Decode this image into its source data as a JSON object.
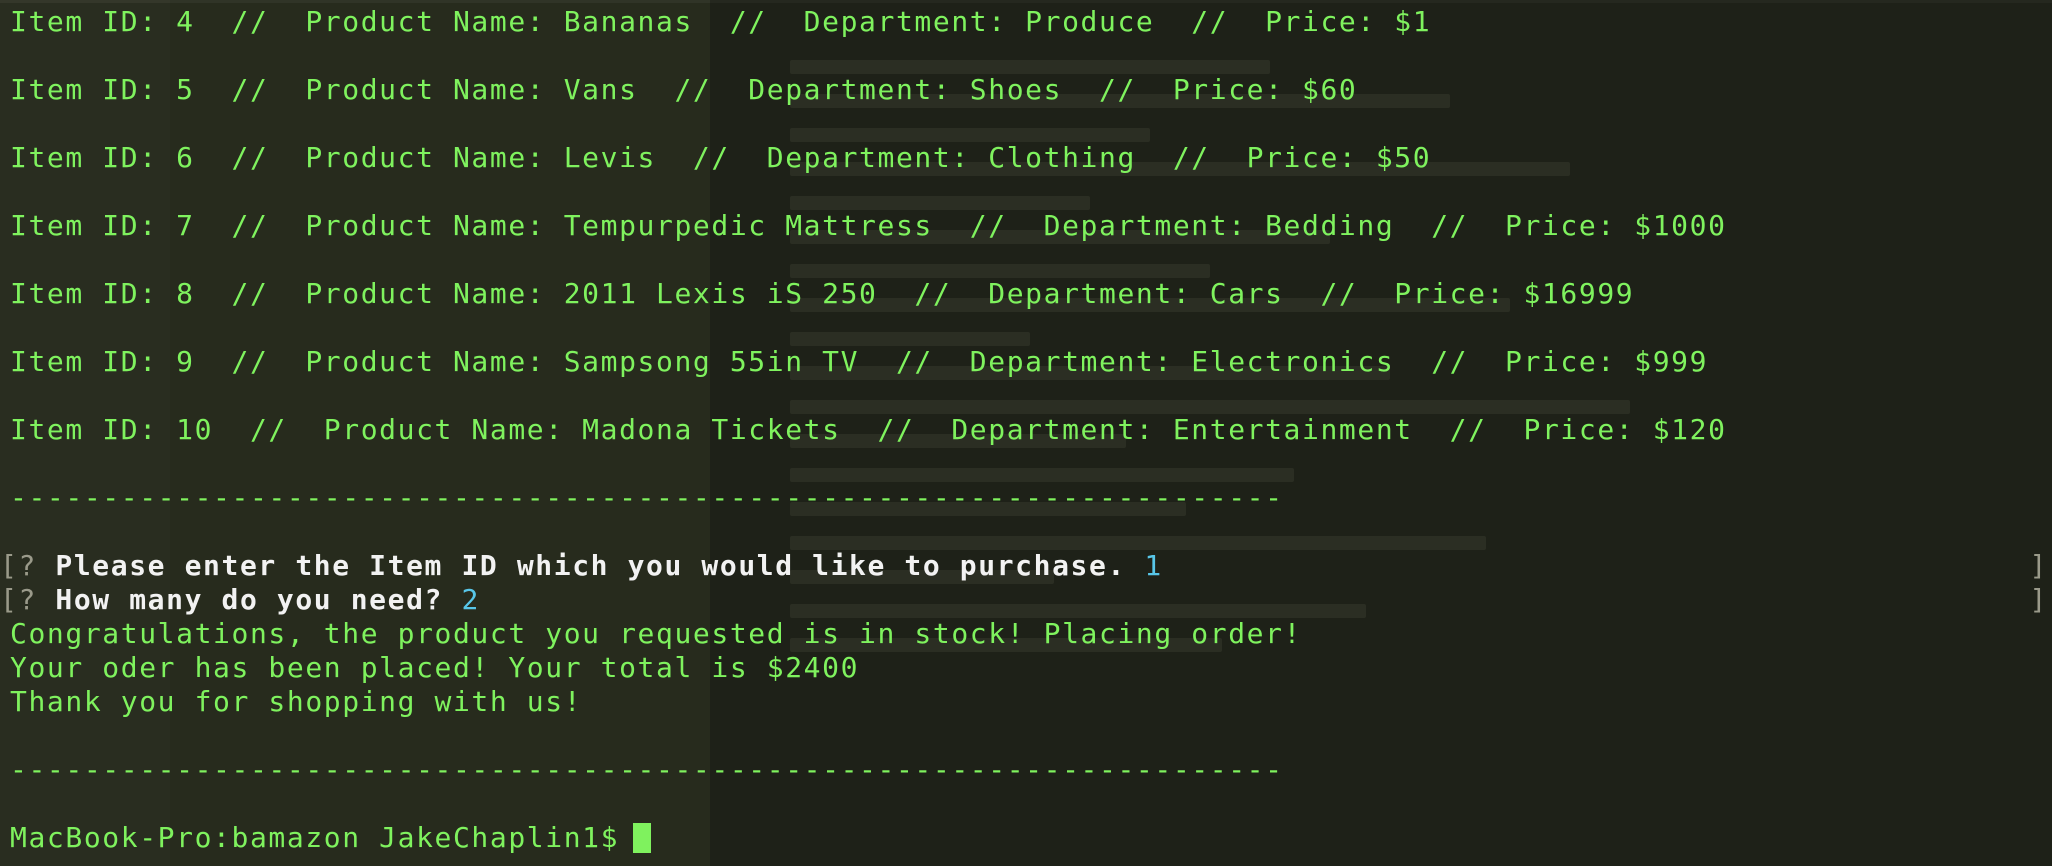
{
  "inventory": [
    {
      "text": "Item ID: 4  //  Product Name: Bananas  //  Department: Produce  //  Price: $1"
    },
    {
      "text": "Item ID: 5  //  Product Name: Vans  //  Department: Shoes  //  Price: $60"
    },
    {
      "text": "Item ID: 6  //  Product Name: Levis  //  Department: Clothing  //  Price: $50"
    },
    {
      "text": "Item ID: 7  //  Product Name: Tempurpedic Mattress  //  Department: Bedding  //  Price: $1000"
    },
    {
      "text": "Item ID: 8  //  Product Name: 2011 Lexis iS 250  //  Department: Cars  //  Price: $16999"
    },
    {
      "text": "Item ID: 9  //  Product Name: Sampsong 55in TV  //  Department: Electronics  //  Price: $999"
    },
    {
      "text": "Item ID: 10  //  Product Name: Madona Tickets  //  Department: Entertainment  //  Price: $120"
    }
  ],
  "separator": "---------------------------------------------------------------------",
  "prompts": [
    {
      "mark": "[?",
      "question": "Please enter the Item ID which you would like to purchase.",
      "answer": "1",
      "right_bracket": "]"
    },
    {
      "mark": "[?",
      "question": "How many do you need?",
      "answer": "2",
      "right_bracket": "]"
    }
  ],
  "messages": [
    "Congratulations, the product you requested is in stock! Placing order!",
    "Your oder has been placed! Your total is $2400",
    "Thank you for shopping with us!"
  ],
  "shell_prompt": "MacBook-Pro:bamazon JakeChaplin1$",
  "colors": {
    "output_text": "#7ff25e",
    "prompt_question": "#f2f2f2",
    "prompt_answer": "#58c6e8",
    "background": "#23271b"
  }
}
